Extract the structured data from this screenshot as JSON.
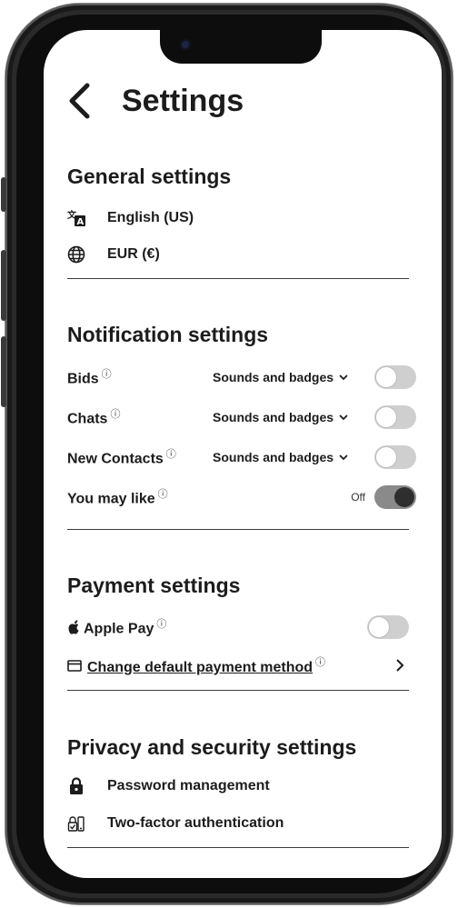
{
  "header": {
    "title": "Settings"
  },
  "general": {
    "title": "General settings",
    "language": "English (US)",
    "currency": "EUR (€)"
  },
  "notifications": {
    "title": "Notification settings",
    "info_symbol": "ⓘ",
    "rows": [
      {
        "label": "Bids",
        "option": "Sounds and badges",
        "enabled": false
      },
      {
        "label": "Chats",
        "option": "Sounds and badges",
        "enabled": false
      },
      {
        "label": "New Contacts",
        "option": "Sounds and badges",
        "enabled": false
      },
      {
        "label": "You may like",
        "status": "Off",
        "enabled": true
      }
    ]
  },
  "payment": {
    "title": "Payment settings",
    "apple_pay": "Apple Pay",
    "apple_pay_enabled": false,
    "change_method": "Change default payment method"
  },
  "privacy": {
    "title": "Privacy and security settings",
    "password": "Password management",
    "two_factor": "Two-factor authentication"
  },
  "icons": {
    "back": "chevron-left-icon",
    "language": "translate-icon",
    "currency": "globe-icon",
    "info": "info-icon",
    "dropdown": "chevron-down-icon",
    "apple": "apple-icon",
    "card": "credit-card-icon",
    "forward": "chevron-right-icon",
    "lock": "lock-icon",
    "two_factor": "two-factor-icon"
  },
  "colors": {
    "text": "#1c1c1c",
    "toggle_off": "#cfcfcf",
    "toggle_on": "#8a8a8a",
    "knob_on": "#2e2e2e"
  }
}
